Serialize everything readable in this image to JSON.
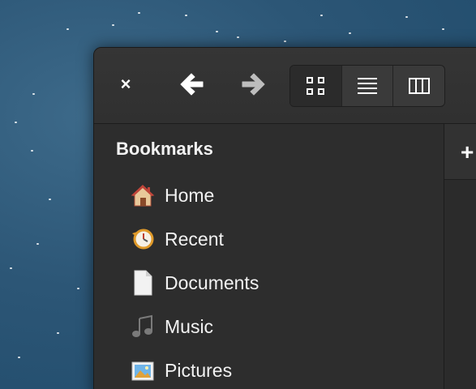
{
  "window": {
    "close_glyph": "×",
    "new_tab_glyph": "+"
  },
  "toolbar": {
    "back_icon": "back-arrow-icon",
    "forward_icon": "forward-arrow-icon",
    "views": [
      {
        "name": "grid-view",
        "active": false
      },
      {
        "name": "list-view",
        "active": true
      },
      {
        "name": "column-view",
        "active": false
      }
    ]
  },
  "sidebar": {
    "heading": "Bookmarks",
    "items": [
      {
        "label": "Home",
        "icon": "home-icon"
      },
      {
        "label": "Recent",
        "icon": "recent-icon"
      },
      {
        "label": "Documents",
        "icon": "documents-icon"
      },
      {
        "label": "Music",
        "icon": "music-icon"
      },
      {
        "label": "Pictures",
        "icon": "pictures-icon"
      }
    ]
  }
}
